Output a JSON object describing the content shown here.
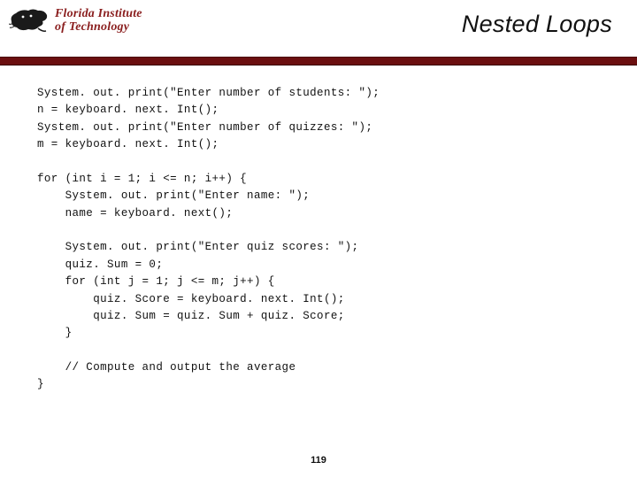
{
  "header": {
    "institution_line1": "Florida Institute",
    "institution_line2": "of Technology",
    "title": "Nested Loops"
  },
  "code": {
    "lines": [
      "System. out. print(\"Enter number of students: \");",
      "n = keyboard. next. Int();",
      "System. out. print(\"Enter number of quizzes: \");",
      "m = keyboard. next. Int();",
      "",
      "for (int i = 1; i <= n; i++) {",
      "    System. out. print(\"Enter name: \");",
      "    name = keyboard. next();",
      "",
      "    System. out. print(\"Enter quiz scores: \");",
      "    quiz. Sum = 0;",
      "    for (int j = 1; j <= m; j++) {",
      "        quiz. Score = keyboard. next. Int();",
      "        quiz. Sum = quiz. Sum + quiz. Score;",
      "    }",
      "",
      "    // Compute and output the average",
      "}"
    ]
  },
  "page_number": "119"
}
